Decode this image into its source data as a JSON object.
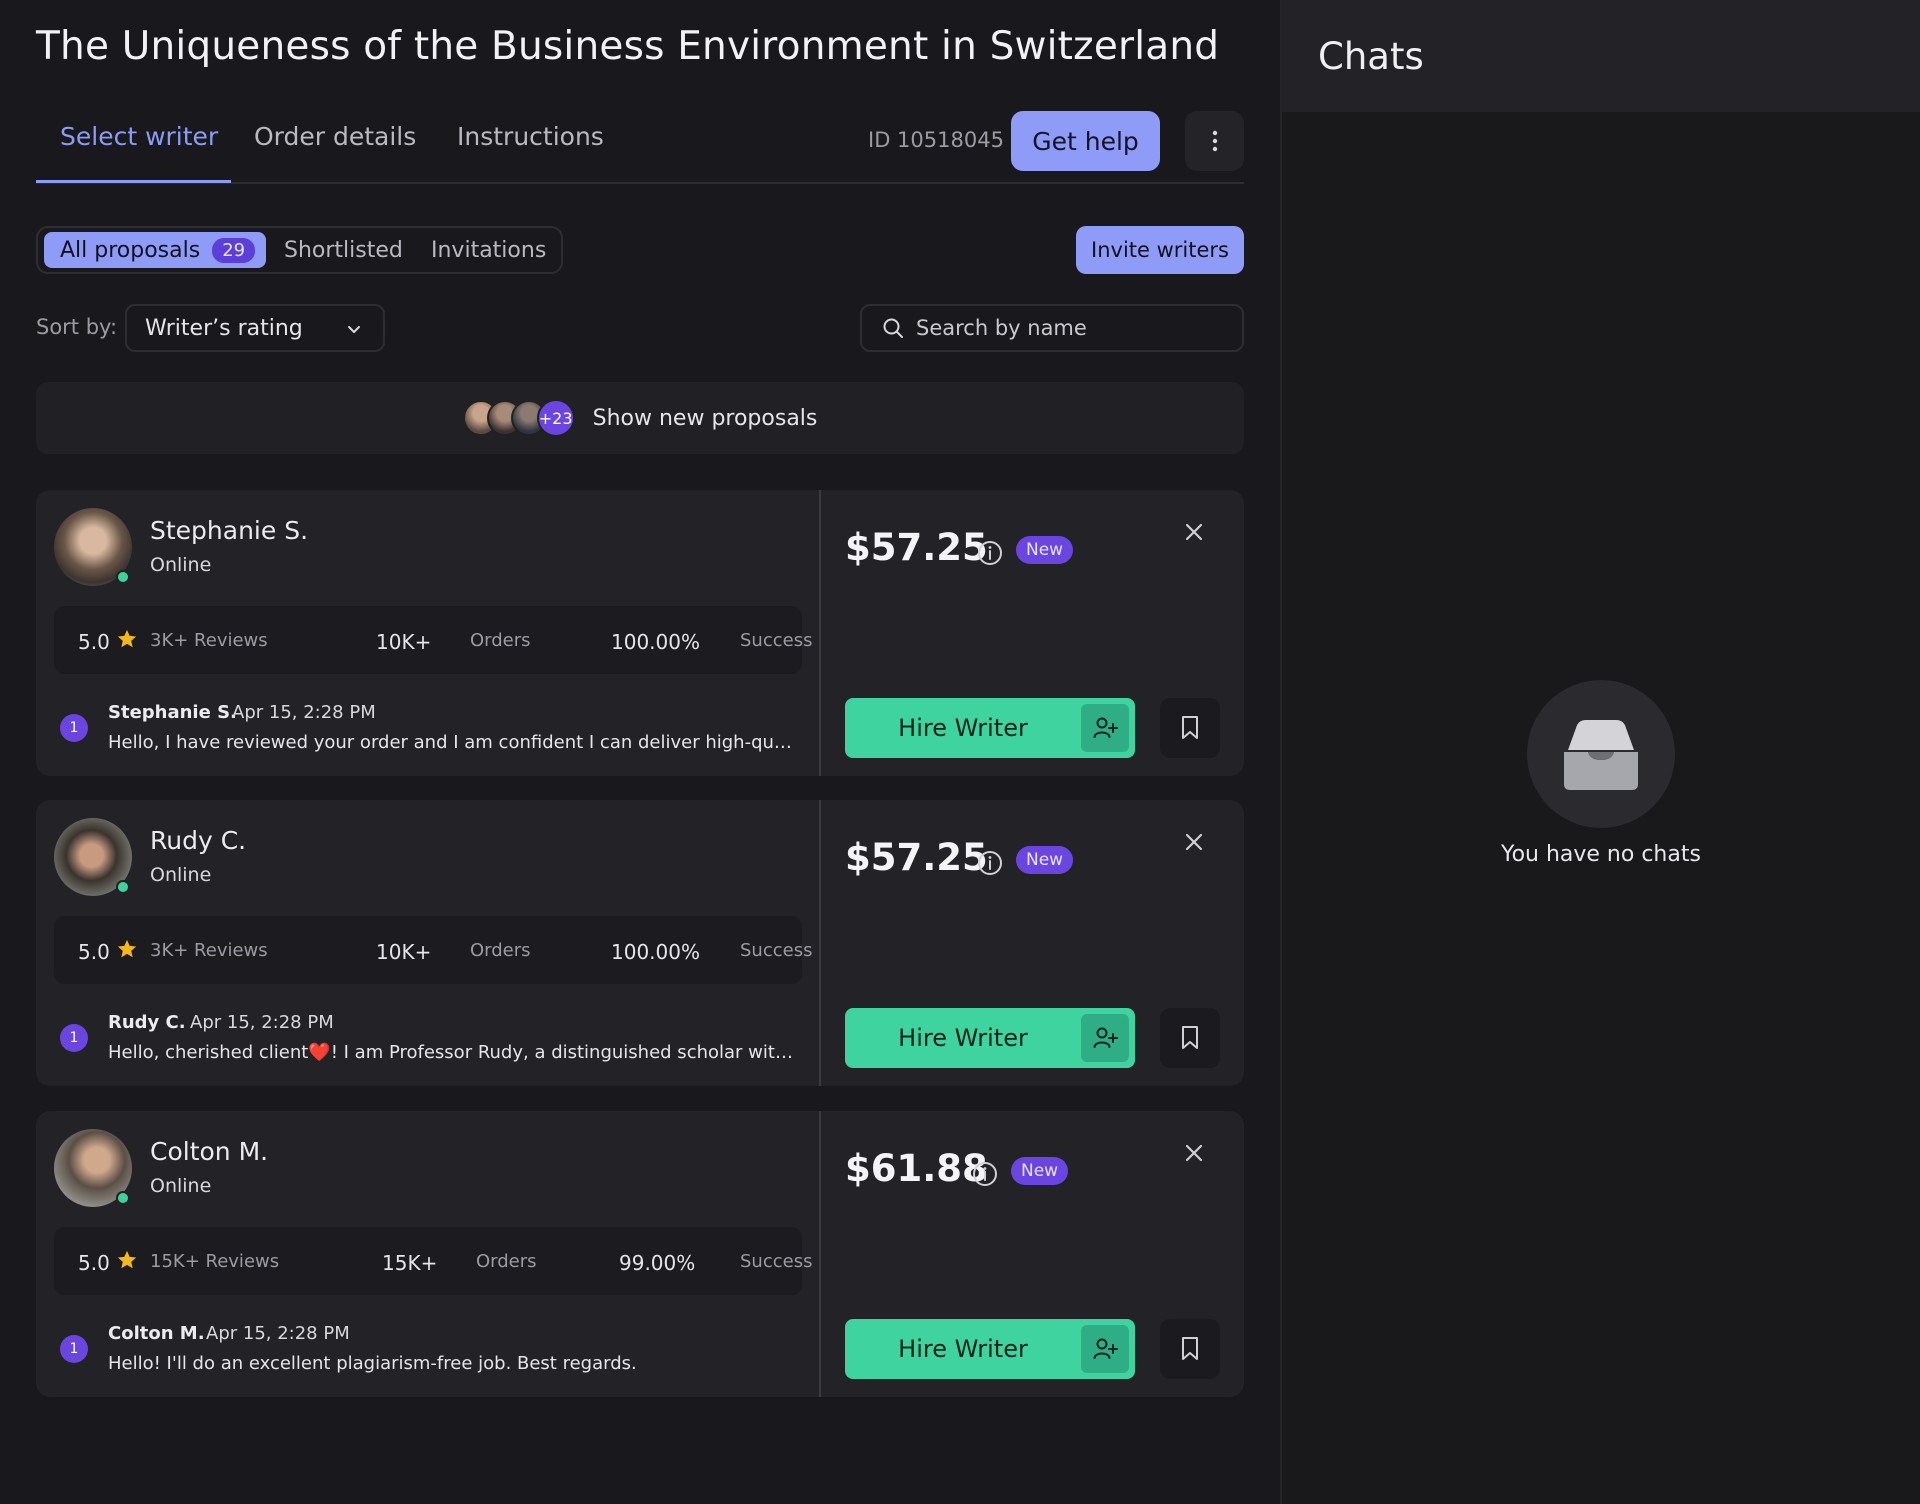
{
  "header": {
    "title": "The Uniqueness of the Business Environment in Switzerland",
    "tabs": [
      {
        "label": "Select writer",
        "active": true
      },
      {
        "label": "Order details",
        "active": false
      },
      {
        "label": "Instructions",
        "active": false
      }
    ],
    "order_id": "ID 10518045",
    "help_label": "Get help",
    "more_icon": "more-vertical-icon"
  },
  "filters": {
    "all_label": "All proposals",
    "all_count": "29",
    "shortlisted_label": "Shortlisted",
    "invitations_label": "Invitations",
    "invite_label": "Invite writers"
  },
  "sort": {
    "label": "Sort by:",
    "value": "Writer’s rating"
  },
  "search": {
    "placeholder": "Search by name"
  },
  "new_proposals": {
    "extra_count": "+23",
    "label": "Show new proposals"
  },
  "colors": {
    "accent": "#8e9bf7",
    "badge": "#6a45e0",
    "hire": "#3fd3a0",
    "online": "#3fd39a",
    "star": "#f5b81c"
  },
  "writers": [
    {
      "name": "Stephanie S.",
      "status": "Online",
      "rating": "5.0",
      "reviews": "3K+ Reviews",
      "orders_num": "10K+",
      "orders_label": "Orders",
      "success_num": "100.00%",
      "success_label": "Success",
      "price": "$57.25",
      "badge": "New",
      "message_count": "1",
      "message_author": "Stephanie S.",
      "message_time": "Apr 15, 2:28 PM",
      "message_text": "Hello, I have reviewed your order and I am confident I can deliver high-qual...",
      "hire_label": "Hire Writer"
    },
    {
      "name": "Rudy C.",
      "status": "Online",
      "rating": "5.0",
      "reviews": "3K+ Reviews",
      "orders_num": "10K+",
      "orders_label": "Orders",
      "success_num": "100.00%",
      "success_label": "Success",
      "price": "$57.25",
      "badge": "New",
      "message_count": "1",
      "message_author": "Rudy C.",
      "message_time": "Apr 15, 2:28 PM",
      "message_text": "Hello, cherished client❤️! I am Professor Rudy, a distinguished scholar with ...",
      "hire_label": "Hire Writer"
    },
    {
      "name": "Colton M.",
      "status": "Online",
      "rating": "5.0",
      "reviews": "15K+ Reviews",
      "orders_num": "15K+",
      "orders_label": "Orders",
      "success_num": "99.00%",
      "success_label": "Success",
      "price": "$61.88",
      "badge": "New",
      "message_count": "1",
      "message_author": "Colton M.",
      "message_time": "Apr 15, 2:28 PM",
      "message_text": "Hello! I'll do an excellent plagiarism-free job. Best regards.",
      "hire_label": "Hire Writer"
    }
  ],
  "chats": {
    "title": "Chats",
    "empty_text": "You have no chats"
  }
}
